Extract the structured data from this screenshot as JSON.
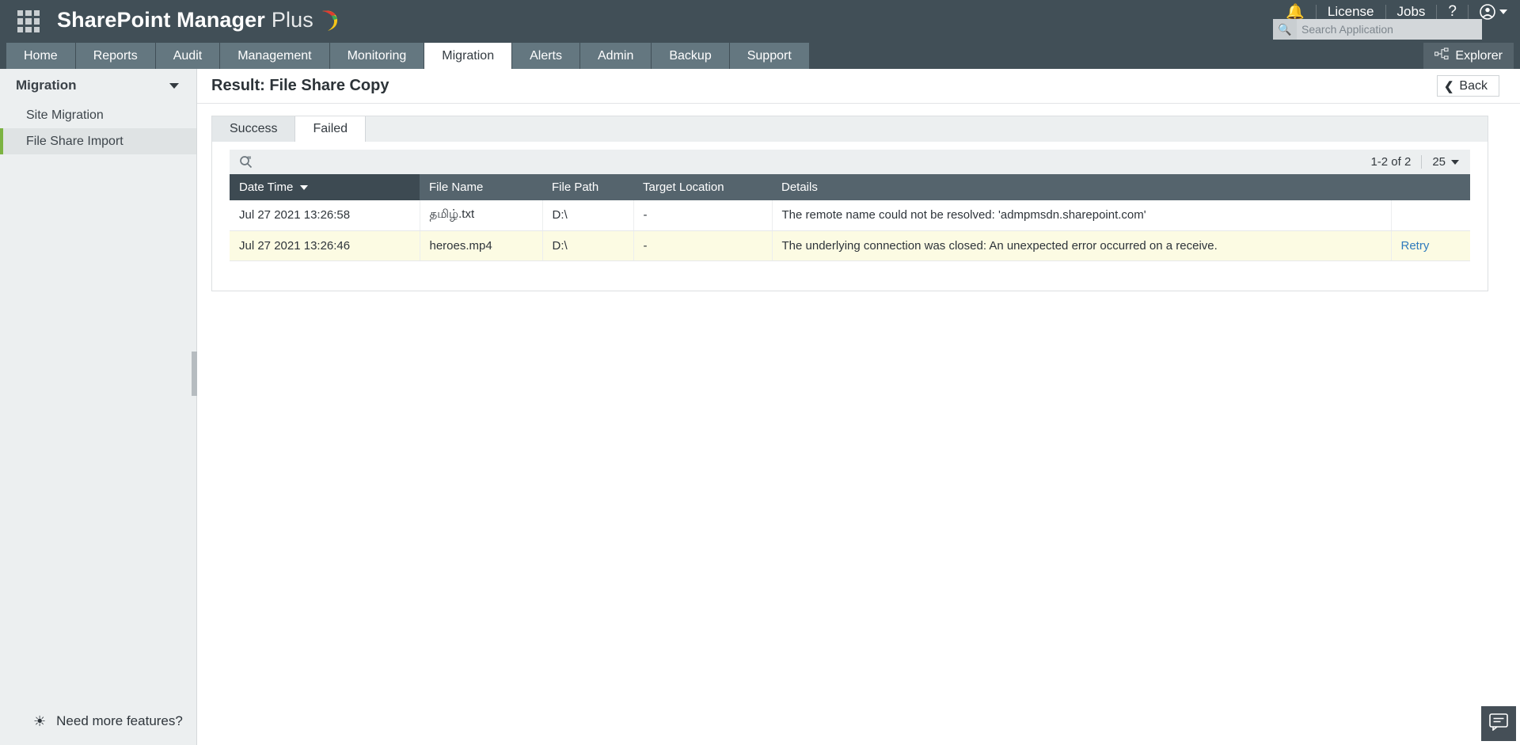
{
  "header": {
    "brand_bold": "SharePoint Manager",
    "brand_light": "Plus",
    "waffle_icon": "app-grid-icon",
    "bell_icon": "notification-bell-icon",
    "license_label": "License",
    "jobs_label": "Jobs",
    "help_icon": "question-mark-icon",
    "help_label": "?",
    "user_icon": "user-account-icon",
    "search": {
      "icon": "search-icon",
      "value": "",
      "placeholder": "Search Application"
    }
  },
  "nav": {
    "items": [
      {
        "label": "Home",
        "active": false
      },
      {
        "label": "Reports",
        "active": false
      },
      {
        "label": "Audit",
        "active": false
      },
      {
        "label": "Management",
        "active": false
      },
      {
        "label": "Monitoring",
        "active": false
      },
      {
        "label": "Migration",
        "active": true
      },
      {
        "label": "Alerts",
        "active": false
      },
      {
        "label": "Admin",
        "active": false
      },
      {
        "label": "Backup",
        "active": false
      },
      {
        "label": "Support",
        "active": false
      }
    ],
    "explorer": {
      "label": "Explorer",
      "icon": "sitemap-icon"
    }
  },
  "sidebar": {
    "section_title": "Migration",
    "collapse_icon": "chevron-down-icon",
    "items": [
      {
        "label": "Site Migration",
        "active": false
      },
      {
        "label": "File Share Import",
        "active": true
      }
    ],
    "footer": {
      "icon": "lightbulb-icon",
      "label": "Need more features?"
    }
  },
  "page": {
    "title": "Result: File Share Copy",
    "back_label": "Back",
    "back_icon": "chevron-left-icon"
  },
  "tabs": [
    {
      "label": "Success",
      "active": false
    },
    {
      "label": "Failed",
      "active": true
    }
  ],
  "toolbar": {
    "search_icon": "search-magnifier-icon",
    "record_range": "1-2 of 2",
    "page_size": "25",
    "page_size_icon": "chevron-down-icon"
  },
  "table": {
    "columns": [
      {
        "label": "Date Time",
        "sorted": true,
        "sort_icon": "sort-descending-arrow"
      },
      {
        "label": "File Name",
        "sorted": false
      },
      {
        "label": "File Path",
        "sorted": false
      },
      {
        "label": "Target Location",
        "sorted": false
      },
      {
        "label": "Details",
        "sorted": false
      },
      {
        "label": "",
        "sorted": false
      }
    ],
    "rows": [
      {
        "date_time": "Jul 27 2021 13:26:58",
        "file_name": "தமிழ்.txt",
        "file_path": "D:\\",
        "target_location": "-",
        "details": "The remote name could not be resolved: 'admpmsdn.sharepoint.com'",
        "action": ""
      },
      {
        "date_time": "Jul 27 2021 13:26:46",
        "file_name": "heroes.mp4",
        "file_path": "D:\\",
        "target_location": "-",
        "details": "The underlying connection was closed: An unexpected error occurred on a receive.",
        "action": "Retry"
      }
    ]
  },
  "chat": {
    "icon": "chat-bubble-icon"
  },
  "colors": {
    "header_bg": "#414f57",
    "nav_tab_bg": "#647780",
    "table_header_bg": "#55646d",
    "sorted_header_bg": "#3d4a52",
    "alt_row_bg": "#fcfbe3",
    "link": "#2f7bbd",
    "accent_green": "#7cb342",
    "bell_yellow": "#f5c518"
  }
}
